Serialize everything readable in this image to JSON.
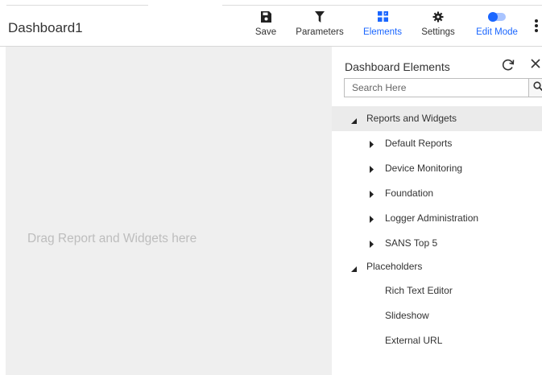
{
  "header": {
    "title": "Dashboard1",
    "toolbar": {
      "save_label": "Save",
      "parameters_label": "Parameters",
      "elements_label": "Elements",
      "settings_label": "Settings",
      "edit_mode_label": "Edit Mode"
    }
  },
  "canvas": {
    "drop_hint": "Drag Report and Widgets here"
  },
  "panel": {
    "title": "Dashboard Elements",
    "search_placeholder": "Search Here",
    "tree": {
      "reports_group": "Reports and Widgets",
      "reports_items": [
        "Default Reports",
        "Device Monitoring",
        "Foundation",
        "Logger Administration",
        "SANS Top 5"
      ],
      "placeholders_group": "Placeholders",
      "placeholder_items": [
        "Rich Text Editor",
        "Slideshow",
        "External URL"
      ]
    }
  },
  "colors": {
    "accent": "#1a66ff",
    "canvas_bg": "#efefef",
    "selected_row": "#ebebeb"
  }
}
